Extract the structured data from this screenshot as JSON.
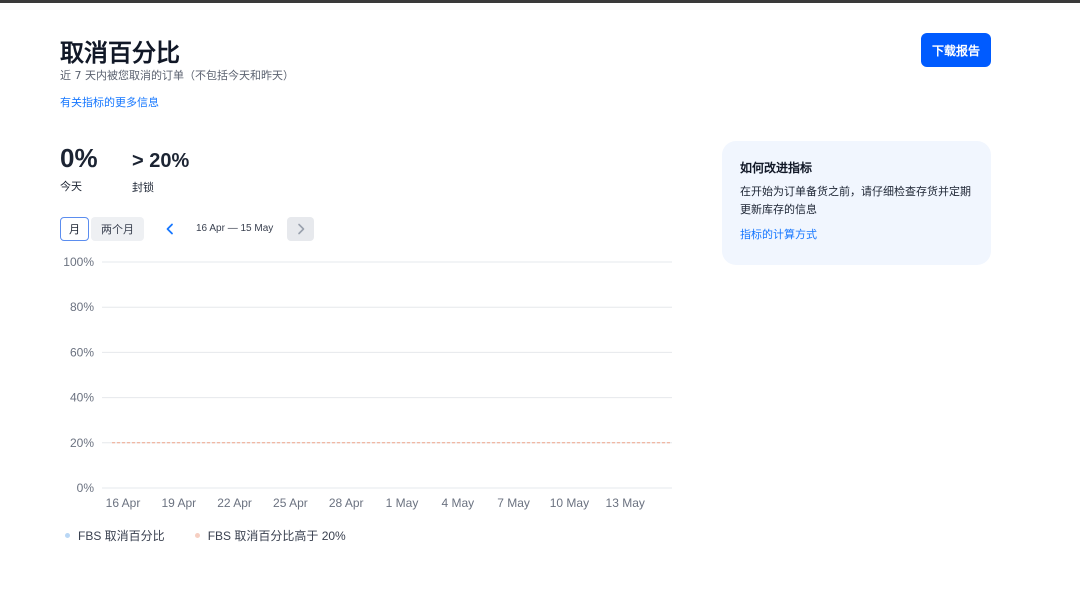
{
  "header": {
    "title": "取消百分比",
    "subtitle": "近 7 天内被您取消的订单（不包括今天和昨天）",
    "more_link": "有关指标的更多信息",
    "download_label": "下载报告"
  },
  "metrics": [
    {
      "value": "0%",
      "label": "今天"
    },
    {
      "value": "> 20%",
      "label": "封锁"
    }
  ],
  "period": {
    "options": [
      "月",
      "两个月"
    ],
    "selected": "月",
    "date_range": "16 Apr — 15 May"
  },
  "info_card": {
    "title": "如何改进指标",
    "body": "在开始为订单备货之前，请仔细检查存货并定期更新库存的信息",
    "link": "指标的计算方式"
  },
  "colors": {
    "accent": "#005bff",
    "link": "#1677ff",
    "series": "#b9d7f5",
    "threshold": "#f0a48a",
    "card_bg": "#f1f6fe"
  },
  "chart_data": {
    "type": "line",
    "x": [
      "16 Apr",
      "19 Apr",
      "22 Apr",
      "25 Apr",
      "28 Apr",
      "1 May",
      "4 May",
      "7 May",
      "10 May",
      "13 May"
    ],
    "y_ticks": [
      "100%",
      "80%",
      "60%",
      "40%",
      "20%",
      "0%"
    ],
    "ylim": [
      0,
      100
    ],
    "series": [
      {
        "name": "FBS 取消百分比",
        "values": []
      },
      {
        "name": "FBS 取消百分比高于 20%",
        "threshold": 20
      }
    ],
    "grid": true,
    "legend": "bottom-left"
  }
}
